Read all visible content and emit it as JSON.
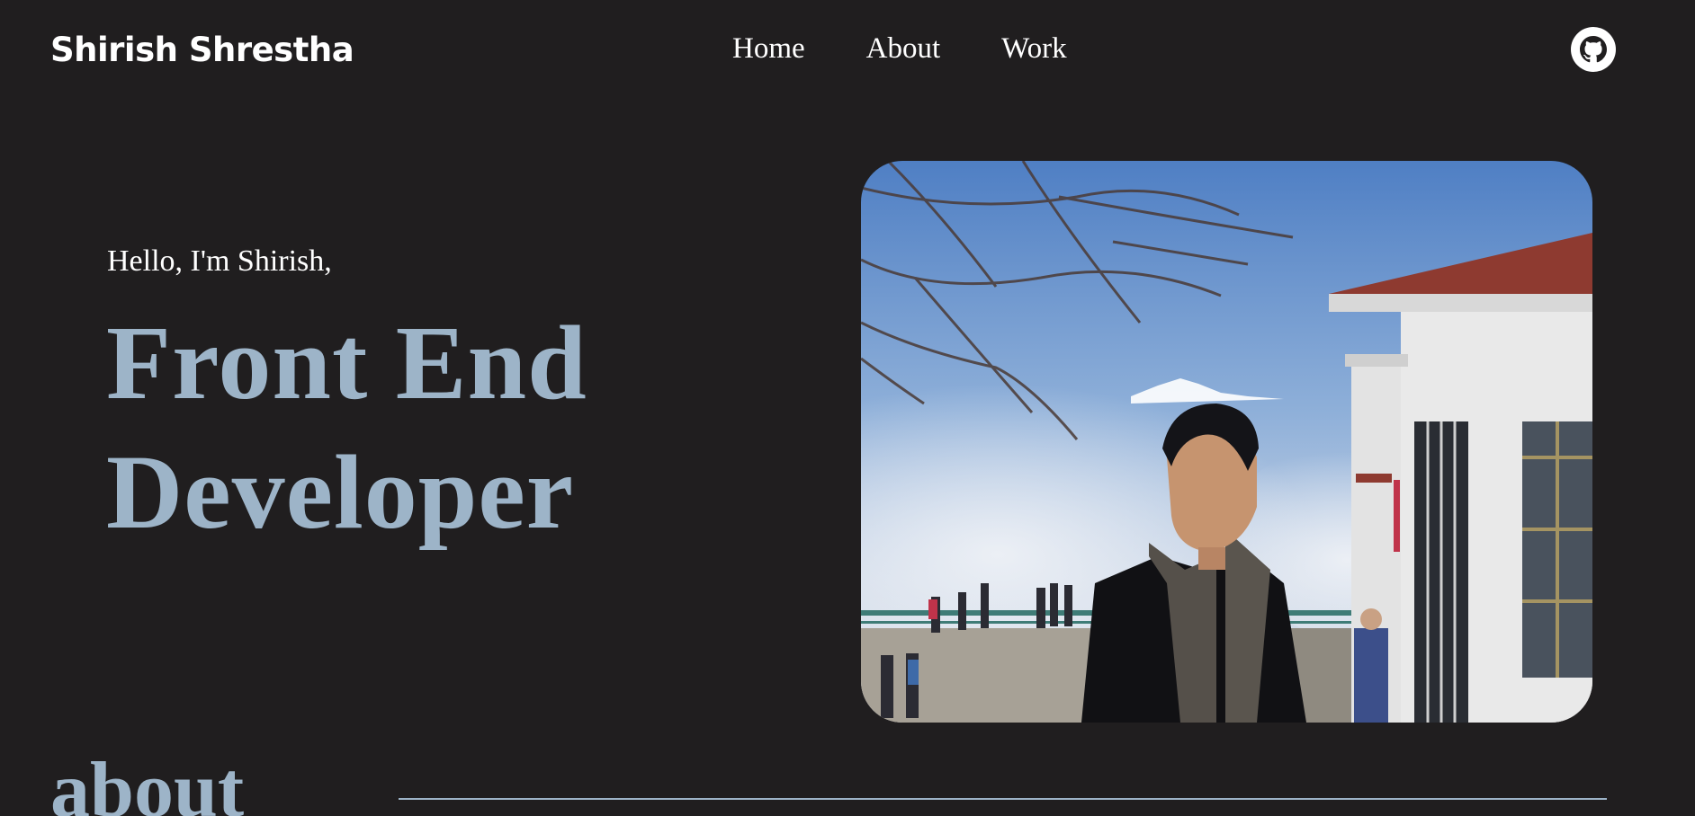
{
  "header": {
    "brand": "Shirish Shrestha",
    "nav": [
      {
        "label": "Home"
      },
      {
        "label": "About"
      },
      {
        "label": "Work"
      }
    ],
    "github_icon": "github-icon"
  },
  "hero": {
    "greeting": "Hello, I'm Shirish,",
    "title_line1": "Front End",
    "title_line2": "Developer",
    "photo": "portrait-photo"
  },
  "about": {
    "heading": "about"
  },
  "colors": {
    "background": "#201e1f",
    "accent": "#9db4c8",
    "text": "#ffffff"
  }
}
